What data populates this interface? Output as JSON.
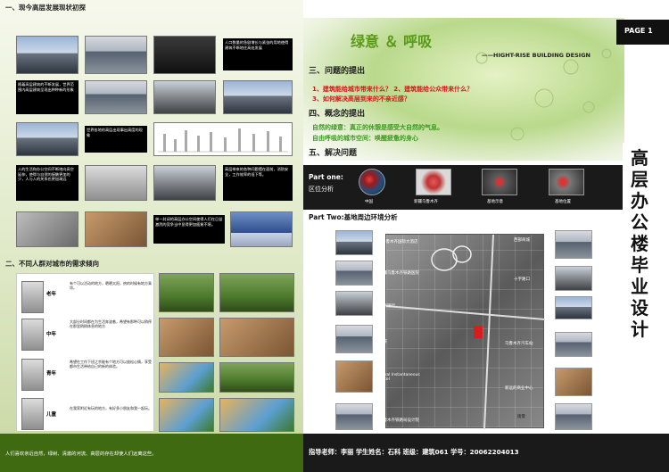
{
  "left": {
    "section1_title": "一、现今高层发展现状初探",
    "captions": [
      "人口数量的急剧增长与紧张的用地使得建筑不断地往高处发展",
      "随着高层建筑的不断发展，世界范围内高层建筑呈现出种种新的形象",
      "世界各地的高层出现事出高度的现象",
      "人的生活和办公空间不断地向高空延伸，使得与自然的接触更加的少，人与人的关系也更加疏远",
      "高层带来的各种问题摆在面前，消防安全，工作效率的低下等。",
      "单一封闭的高层办公空间使得人们在日益激烈的竞争当中显得更加疲惫不堪。"
    ],
    "section2_title": "二、不同人群对城市的需求倾向",
    "groups": [
      {
        "label": "老年",
        "text": "有个可以活动的地方，晒晒太阳，热的时候有地方乘凉。"
      },
      {
        "label": "中年",
        "text": "大部分时间都在为生活奔波着，希望有那种可以稍停在那里稍稍休息的地方"
      },
      {
        "label": "青年",
        "text": "希望在工作下班之余能有个地方可以放松心情，享受都市生活带给自己的新的体验。"
      },
      {
        "label": "儿童",
        "text": "在我家附近有玩的地方，有好多小朋友和我一起玩。"
      }
    ],
    "footer_text": "人们喜欢亲近自然，绿树、清澈的河流、高层的存在却使人们远离这些。"
  },
  "right": {
    "page_label": "PAGE 1",
    "theme_title": "绿意 ＆ 呼吸",
    "english_subtitle": "——HIGHT-RISE BUILDING DESIGN",
    "section3_title": "三、问题的提出",
    "q1": "1、建筑能给城市带来什么？ 2、建筑能给公众带来什么？",
    "q2": "3、如何解决高层到来的不亲近感？",
    "section4_title": "四、概念的提出",
    "concept1": "自然的绿意：真正的休憩是感受大自然的气息。",
    "concept2": "自由呼吸的城市空间：唤醒疲惫的身心",
    "section5_title": "五、解决问题",
    "part_one_title": "Part one:",
    "part_one_sub": "区位分析",
    "location_labels": [
      "中国",
      "新疆乌鲁木齐",
      "基地示意",
      "基地位置"
    ],
    "part_two_title": "Part Two:基地周边环境分析",
    "map_labels": [
      "乌鲁木齐国际大酒店",
      "新疆乌鲁木齐铁路医院",
      "招商银行",
      "医院",
      "Royal Instantaneous Hotel",
      "乌鲁木齐铁路局设计院",
      "西部商城",
      "十字路口",
      "乌鲁木齐汽车站",
      "新远的商业中心",
      "街景"
    ],
    "vertical_title": [
      "高",
      "层",
      "办",
      "公",
      "楼",
      "毕",
      "业",
      "设",
      "计"
    ],
    "footer": "指导老师：李丽    学生姓名：石科   班级：建筑061    学号：20062204013"
  },
  "colors": {
    "accent_green": "#4d7d16",
    "question_red": "#d11818",
    "concept_green": "#3c9a1f",
    "footer_left": "#3f6a12",
    "footer_right": "#1a1a1a"
  }
}
